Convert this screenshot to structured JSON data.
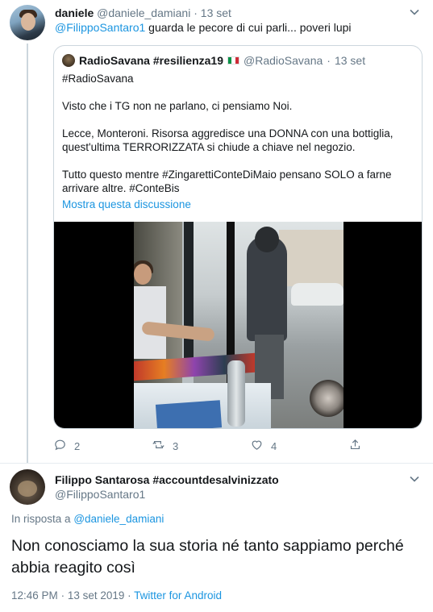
{
  "tweet1": {
    "name": "daniele",
    "handle": "@daniele_damiani",
    "separator": "·",
    "date": "13 set",
    "mention": "@FilippoSantaro1",
    "text": "guarda le pecore di cui parli... poveri lupi",
    "quote": {
      "name": "RadioSavana #resilienza19",
      "handle": "@RadioSavana",
      "separator": "·",
      "date": "13 set",
      "flag_colors": [
        "#009246",
        "#ffffff",
        "#ce2b37"
      ],
      "paragraphs": [
        "#RadioSavana",
        "Visto che i TG non ne parlano, ci pensiamo Noi.",
        "Lecce, Monteroni. Risorsa aggredisce una DONNA con una bottiglia, quest'ultima TERRORIZZATA si chiude a chiave nel negozio.",
        "Tutto questo mentre #ZingarettiConteDiMaio pensano SOLO a farne arrivare altre. #ConteBis"
      ],
      "show_thread": "Mostra questa discussione"
    },
    "actions": {
      "replies": "2",
      "retweets": "3",
      "likes": "4"
    }
  },
  "reply": {
    "name": "Filippo Santarosa #accountdesalvinizzato",
    "handle": "@FilippoSantaro1",
    "in_reply_prefix": "In risposta a",
    "in_reply_to": "@daniele_damiani",
    "text": "Non conosciamo la sua storia né tanto sappiamo perché abbia reagito così",
    "time": "12:46 PM",
    "separator": "·",
    "date": "13 set 2019",
    "client": "Twitter for Android"
  },
  "icons": {
    "reply": "comment-icon",
    "retweet": "retweet-icon",
    "like": "heart-icon",
    "share": "share-icon",
    "caret": "chevron-down-icon"
  },
  "colors": {
    "link": "#1b95e0",
    "muted": "#657786",
    "text": "#14171a",
    "border": "#ccd6dd"
  }
}
